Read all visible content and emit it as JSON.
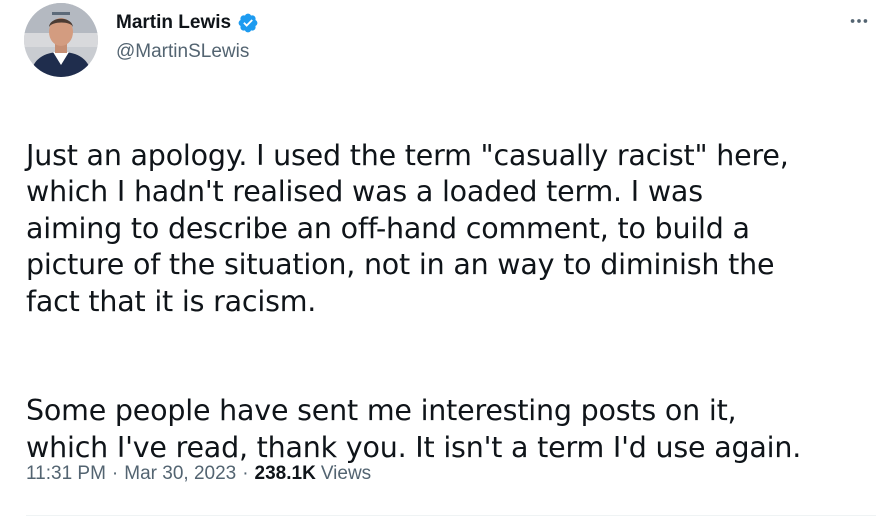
{
  "author": {
    "display_name": "Martin Lewis",
    "handle": "@MartinSLewis",
    "verified_icon": "verified-badge-icon",
    "verified_color": "#1d9bf0"
  },
  "tweet": {
    "paragraphs": [
      "Just an apology. I used the term \"casually racist\" here,\nwhich I hadn't realised was a loaded term. I was\naiming to describe an off-hand comment, to build a\npicture of the situation, not in an way to diminish the\nfact that it is racism.",
      "Some people have sent me interesting posts on it,\nwhich I've read, thank you. It isn't a term I'd use again."
    ]
  },
  "meta": {
    "time": "11:31 PM",
    "separator": "·",
    "date": "Mar 30, 2023",
    "views_count": "238.1K",
    "views_label": "Views"
  },
  "icons": {
    "more": "more-options-icon"
  },
  "colors": {
    "text_primary": "#0f1419",
    "text_secondary": "#536471",
    "accent": "#1d9bf0"
  }
}
